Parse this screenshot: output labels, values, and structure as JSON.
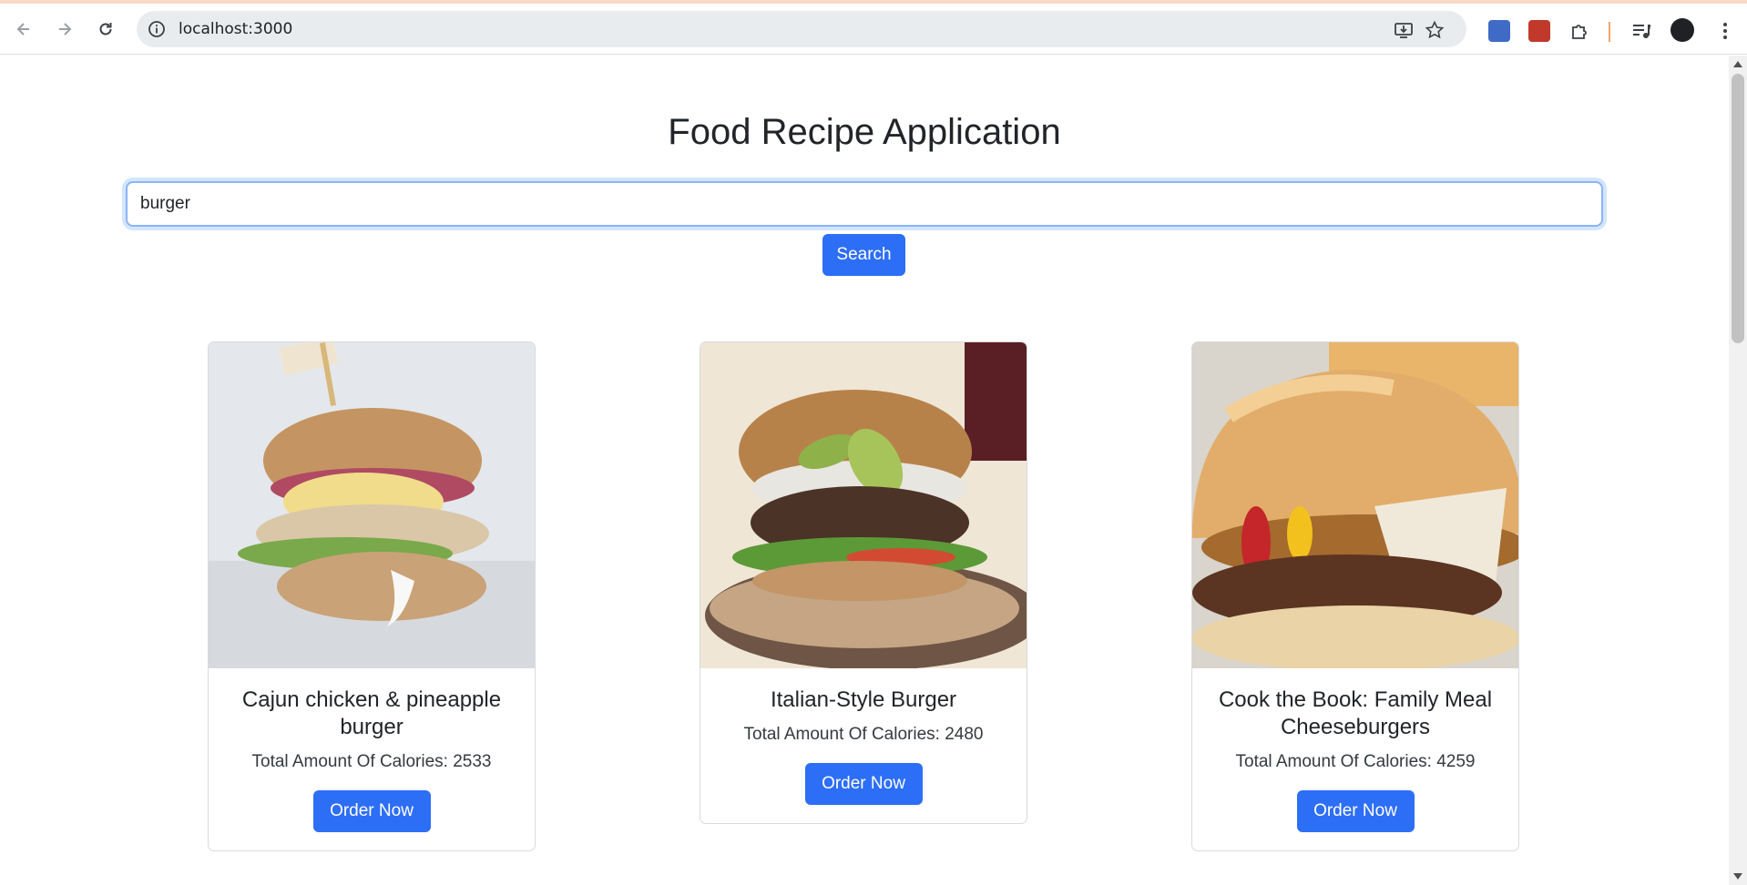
{
  "browser": {
    "url": "localhost:3000"
  },
  "page": {
    "title": "Food Recipe Application",
    "search": {
      "value": "burger",
      "button_label": "Search"
    },
    "recipes": [
      {
        "name": "Cajun chicken & pineapple burger",
        "calories_text": "Total Amount Of Calories: 2533",
        "button_label": "Order Now"
      },
      {
        "name": "Italian-Style Burger",
        "calories_text": "Total Amount Of Calories: 2480",
        "button_label": "Order Now"
      },
      {
        "name": "Cook the Book: Family Meal Cheeseburgers",
        "calories_text": "Total Amount Of Calories: 4259",
        "button_label": "Order Now"
      }
    ]
  },
  "colors": {
    "primary_button": "#2d6ef6",
    "focus_border": "#8bb4f8",
    "text": "#212529"
  },
  "icons": [
    "back-arrow-icon",
    "forward-arrow-icon",
    "reload-icon",
    "site-info-icon",
    "install-app-icon",
    "bookmark-star-icon",
    "extensions-puzzle-icon",
    "media-control-icon",
    "profile-avatar-icon",
    "more-menu-icon"
  ]
}
